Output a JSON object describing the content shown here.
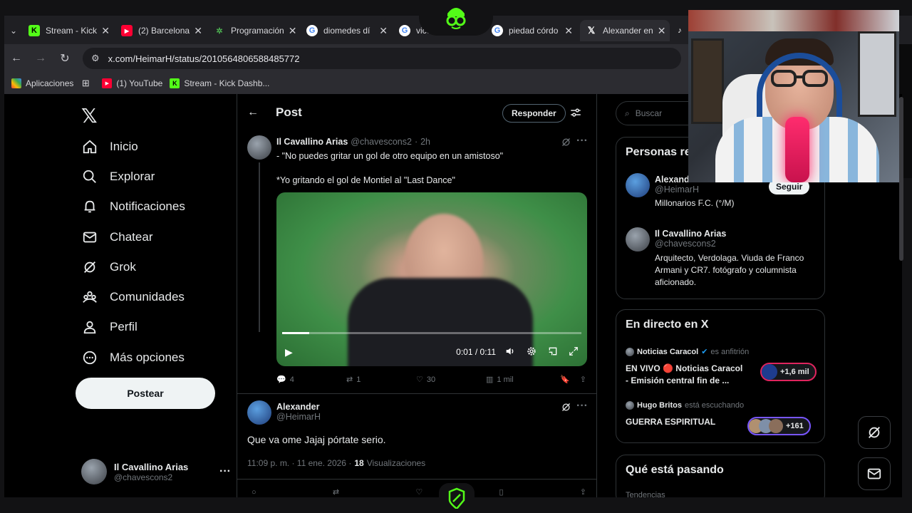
{
  "tabs": [
    {
      "label": "Stream - Kick",
      "favicon": "kick-icon",
      "color": "#53fc18"
    },
    {
      "label": "(2) Barcelona",
      "favicon": "youtube-icon",
      "color": "#ff0033"
    },
    {
      "label": "Programación",
      "favicon": "app-icon",
      "color": "#4caf50"
    },
    {
      "label": "diomedes dí",
      "favicon": "google-icon",
      "color": "#ffffff"
    },
    {
      "label": "vice",
      "favicon": "google-icon",
      "color": "#ffffff"
    },
    {
      "label": "piedad córdo",
      "favicon": "google-icon",
      "color": "#ffffff"
    },
    {
      "label": "Alexander en",
      "favicon": "x-icon",
      "color": "#ffffff"
    }
  ],
  "address": {
    "url": "x.com/HeimarH/status/2010564806588485772"
  },
  "bookmarks": [
    {
      "label": "Aplicaciones"
    },
    {
      "label": "(1) YouTube"
    },
    {
      "label": "Stream - Kick Dashb..."
    }
  ],
  "nav": [
    {
      "label": "Inicio",
      "icon": "home-icon"
    },
    {
      "label": "Explorar",
      "icon": "search-icon"
    },
    {
      "label": "Notificaciones",
      "icon": "bell-icon"
    },
    {
      "label": "Chatear",
      "icon": "mail-icon"
    },
    {
      "label": "Grok",
      "icon": "grok-icon"
    },
    {
      "label": "Comunidades",
      "icon": "people-icon"
    },
    {
      "label": "Perfil",
      "icon": "person-icon"
    },
    {
      "label": "Más opciones",
      "icon": "more-icon"
    }
  ],
  "post_button": "Postear",
  "account": {
    "name": "Il Cavallino Arias",
    "handle": "@chavescons2",
    "more": "···"
  },
  "header": {
    "title": "Post",
    "reply": "Responder"
  },
  "tweet": {
    "name": "Il Cavallino Arias",
    "handle": "@chavescons2",
    "dot": "·",
    "time": "2h",
    "line1": "- \"No puedes gritar un gol de otro equipo en un amistoso\"",
    "line2": "*Yo gritando el gol de Montiel al \"Last Dance\"",
    "video_time": "0:01 / 0:11",
    "video_progress": 0.09,
    "replies": "4",
    "reposts": "1",
    "likes": "30",
    "views": "1 mil"
  },
  "reply": {
    "name": "Alexander",
    "handle": "@HeimarH",
    "text": "Que va ome Jajaj pórtate serio.",
    "datetime": "11:09 p. m. · 11 ene. 2026 ·",
    "views_count": "18",
    "views_label": "Visualizaciones"
  },
  "right": {
    "search_placeholder": "Buscar",
    "people_title": "Personas re",
    "people": [
      {
        "name": "Alexand...",
        "handle": "@HeimarH",
        "bio": "Millonarios F.C. (°/M)",
        "follow": "Seguir"
      },
      {
        "name": "Il Cavallino Arias",
        "handle": "@chavescons2",
        "bio": "Arquitecto, Verdolaga. Viuda de Franco Armani y CR7. fotógrafo y columnista aficionado."
      }
    ],
    "live_title": "En directo en X",
    "live": [
      {
        "host": "Noticias Caracol",
        "role": "es anfitrión",
        "title1": "EN VIVO 🔴 Noticias Caracol",
        "title2": "- Emisión central fin de ...",
        "count": "+1,6 mil"
      },
      {
        "host": "Hugo Britos",
        "role": "está escuchando",
        "title1": "GUERRA ESPIRITUAL",
        "count": "+161"
      }
    ],
    "trending_title": "Qué está pasando",
    "trending_sub": "Tendencias"
  },
  "colors": {
    "accent": "#1d9bf0",
    "brand_green": "#53fc18",
    "live_red": "#e0245e"
  }
}
